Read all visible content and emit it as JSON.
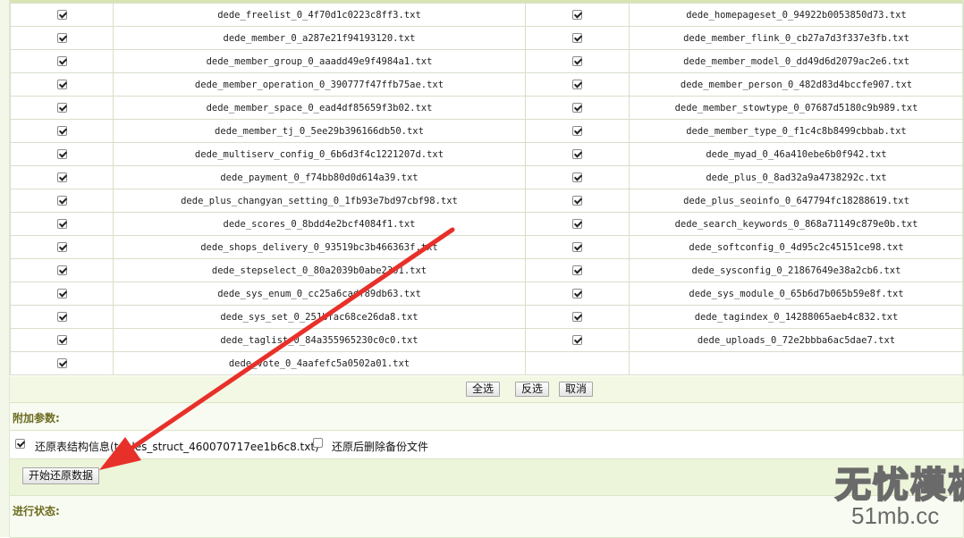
{
  "files": [
    {
      "left": {
        "checked": true,
        "name": "dede_freelist_0_4f70d1c0223c8ff3.txt"
      },
      "right": {
        "checked": true,
        "name": "dede_homepageset_0_94922b0053850d73.txt"
      }
    },
    {
      "left": {
        "checked": true,
        "name": "dede_member_0_a287e21f94193120.txt"
      },
      "right": {
        "checked": true,
        "name": "dede_member_flink_0_cb27a7d3f337e3fb.txt"
      }
    },
    {
      "left": {
        "checked": true,
        "name": "dede_member_group_0_aaadd49e9f4984a1.txt"
      },
      "right": {
        "checked": true,
        "name": "dede_member_model_0_dd49d6d2079ac2e6.txt"
      }
    },
    {
      "left": {
        "checked": true,
        "name": "dede_member_operation_0_390777f47ffb75ae.txt"
      },
      "right": {
        "checked": true,
        "name": "dede_member_person_0_482d83d4bccfe907.txt"
      }
    },
    {
      "left": {
        "checked": true,
        "name": "dede_member_space_0_ead4df85659f3b02.txt"
      },
      "right": {
        "checked": true,
        "name": "dede_member_stowtype_0_07687d5180c9b989.txt"
      }
    },
    {
      "left": {
        "checked": true,
        "name": "dede_member_tj_0_5ee29b396166db50.txt"
      },
      "right": {
        "checked": true,
        "name": "dede_member_type_0_f1c4c8b8499cbbab.txt"
      }
    },
    {
      "left": {
        "checked": true,
        "name": "dede_multiserv_config_0_6b6d3f4c1221207d.txt"
      },
      "right": {
        "checked": true,
        "name": "dede_myad_0_46a410ebe6b0f942.txt"
      }
    },
    {
      "left": {
        "checked": true,
        "name": "dede_payment_0_f74bb80d0d614a39.txt"
      },
      "right": {
        "checked": true,
        "name": "dede_plus_0_8ad32a9a4738292c.txt"
      }
    },
    {
      "left": {
        "checked": true,
        "name": "dede_plus_changyan_setting_0_1fb93e7bd97cbf98.txt"
      },
      "right": {
        "checked": true,
        "name": "dede_plus_seoinfo_0_647794fc18288619.txt"
      }
    },
    {
      "left": {
        "checked": true,
        "name": "dede_scores_0_8bdd4e2bcf4084f1.txt"
      },
      "right": {
        "checked": true,
        "name": "dede_search_keywords_0_868a71149c879e0b.txt"
      }
    },
    {
      "left": {
        "checked": true,
        "name": "dede_shops_delivery_0_93519bc3b466363f.txt"
      },
      "right": {
        "checked": true,
        "name": "dede_softconfig_0_4d95c2c45151ce98.txt"
      }
    },
    {
      "left": {
        "checked": true,
        "name": "dede_stepselect_0_80a2039b0abe2301.txt"
      },
      "right": {
        "checked": true,
        "name": "dede_sysconfig_0_21867649e38a2cb6.txt"
      }
    },
    {
      "left": {
        "checked": true,
        "name": "dede_sys_enum_0_cc25a6cadf89db63.txt"
      },
      "right": {
        "checked": true,
        "name": "dede_sys_module_0_65b6d7b065b59e8f.txt"
      }
    },
    {
      "left": {
        "checked": true,
        "name": "dede_sys_set_0_251bfac68ce26da8.txt"
      },
      "right": {
        "checked": true,
        "name": "dede_tagindex_0_14288065aeb4c832.txt"
      }
    },
    {
      "left": {
        "checked": true,
        "name": "dede_taglist_0_84a355965230c0c0.txt"
      },
      "right": {
        "checked": true,
        "name": "dede_uploads_0_72e2bbba6ac5dae7.txt"
      }
    },
    {
      "left": {
        "checked": true,
        "name": "dede_vote_0_4aafefc5a0502a01.txt"
      },
      "right": null
    }
  ],
  "buttons": {
    "select_all": "全选",
    "invert": "反选",
    "cancel": "取消",
    "start": "开始还原数据"
  },
  "extra_params": {
    "heading": "附加参数:",
    "restore_structure": {
      "checked": true,
      "label": "还原表结构信息(tables_struct_460070717ee1b6c8.txt)"
    },
    "delete_after": {
      "checked": false,
      "label": "还原后删除备份文件"
    }
  },
  "status": {
    "heading": "进行状态:"
  },
  "annotation": {
    "arrow_color": "#e8302a",
    "icon": "red-arrow-icon"
  },
  "watermark": {
    "title": "无忧模板",
    "url": "51mb.cc"
  }
}
